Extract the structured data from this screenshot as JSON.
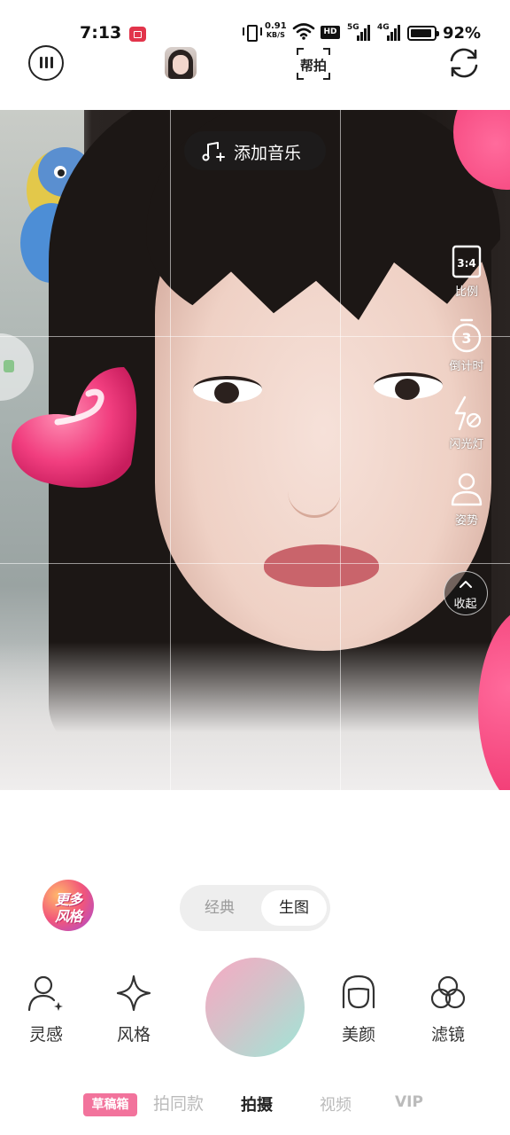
{
  "status_bar": {
    "time": "7:13",
    "net_speed_value": "0.91",
    "net_speed_unit": "KB/S",
    "hd_badge": "HD",
    "sim1_label": "5G",
    "sim2_label": "4G",
    "battery_level": 0.92,
    "battery_percent": "92%"
  },
  "toolbar": {
    "help_label": "帮拍"
  },
  "preview": {
    "music_label": "添加音乐",
    "side_tools": [
      {
        "icon": "ratio-icon",
        "glyph": "3:4",
        "label": "比例"
      },
      {
        "icon": "timer-icon",
        "glyph": "3",
        "label": "倒计时"
      },
      {
        "icon": "flash-off-icon",
        "label": "闪光灯"
      },
      {
        "icon": "pose-icon",
        "label": "姿势"
      }
    ],
    "collapse_label": "收起"
  },
  "controls": {
    "more_style_line1": "更多",
    "more_style_line2": "风格",
    "modes": [
      "经典",
      "生图"
    ],
    "active_mode": "生图",
    "tools_left": [
      {
        "icon": "inspiration-icon",
        "label": "灵感"
      },
      {
        "icon": "style-sparkle-icon",
        "label": "风格"
      }
    ],
    "tools_right": [
      {
        "icon": "beauty-face-icon",
        "label": "美颜"
      },
      {
        "icon": "filter-icon",
        "label": "滤镜"
      }
    ]
  },
  "bottom_nav": {
    "draft_label": "草稿箱",
    "items": [
      "拍同款",
      "拍摄",
      "视频",
      "VIP"
    ],
    "active": "拍摄"
  },
  "colors": {
    "accent_pink": "#f2739c",
    "rec_red": "#e2344b"
  }
}
